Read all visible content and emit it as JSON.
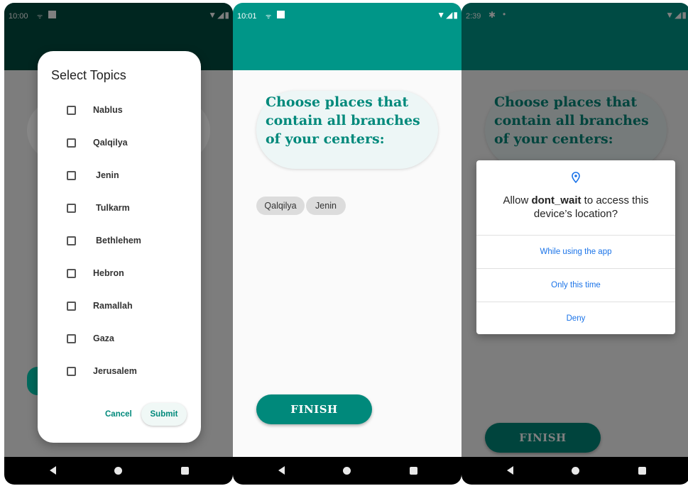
{
  "screens": [
    {
      "status_time": "10:00",
      "dialog": {
        "title": "Select Topics",
        "topics": [
          "Nablus",
          "Qalqilya",
          "Jenin",
          "Tulkarm",
          "Bethlehem",
          "Hebron",
          "Ramallah",
          "Gaza",
          "Jerusalem"
        ],
        "cancel_label": "Cancel",
        "submit_label": "Submit"
      }
    },
    {
      "status_time": "10:01",
      "heading": "Choose places that contain all branches of your centers:",
      "chips": [
        "Qalqilya",
        "Jenin"
      ],
      "finish_label": "FINISH"
    },
    {
      "status_time": "2:39",
      "heading": "Choose places that contain all branches of your centers:",
      "finish_label": "FINISH",
      "permission": {
        "prefix": "Allow ",
        "app_name": "dont_wait",
        "suffix": " to access this device’s location?",
        "options": [
          "While using the app",
          "Only this time",
          "Deny"
        ]
      }
    }
  ],
  "colors": {
    "appbar_dark": "#004d40",
    "appbar_teal": "#009688",
    "accent": "#00897b",
    "link_blue": "#1a73e8"
  },
  "icons": [
    "wifi-icon",
    "signal-icon",
    "battery-icon",
    "location-pin-icon",
    "gear-icon",
    "back-icon",
    "home-icon",
    "recents-icon"
  ]
}
